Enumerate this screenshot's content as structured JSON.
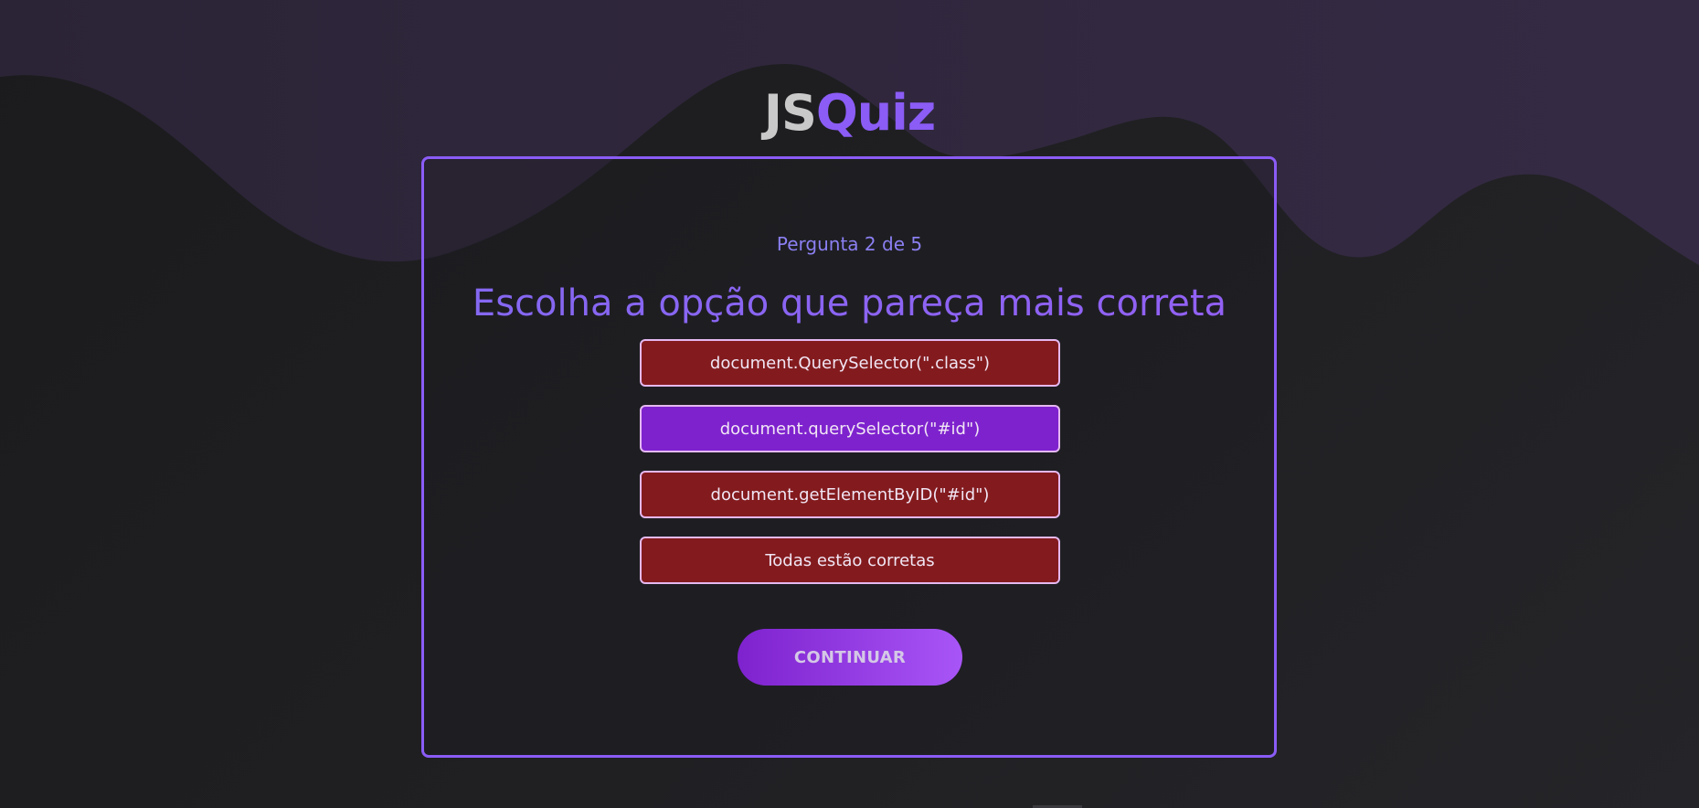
{
  "app": {
    "logo_part1": "JS",
    "logo_part2": "Quiz"
  },
  "quiz": {
    "progress": "Pergunta 2 de 5",
    "question": "Escolha a opção que pareça mais correta",
    "options": [
      {
        "label": "document.QuerySelector(\".class\")",
        "state": "wrong"
      },
      {
        "label": "document.querySelector(\"#id\")",
        "state": "correct"
      },
      {
        "label": "document.getElementByID(\"#id\")",
        "state": "wrong"
      },
      {
        "label": "Todas estão corretas",
        "state": "wrong"
      }
    ],
    "continue_label": "CONTINUAR"
  },
  "colors": {
    "accent": "#8b5cf6",
    "wrong": "#831b1e",
    "correct": "#7e22ce",
    "background": "#1e1e21"
  }
}
